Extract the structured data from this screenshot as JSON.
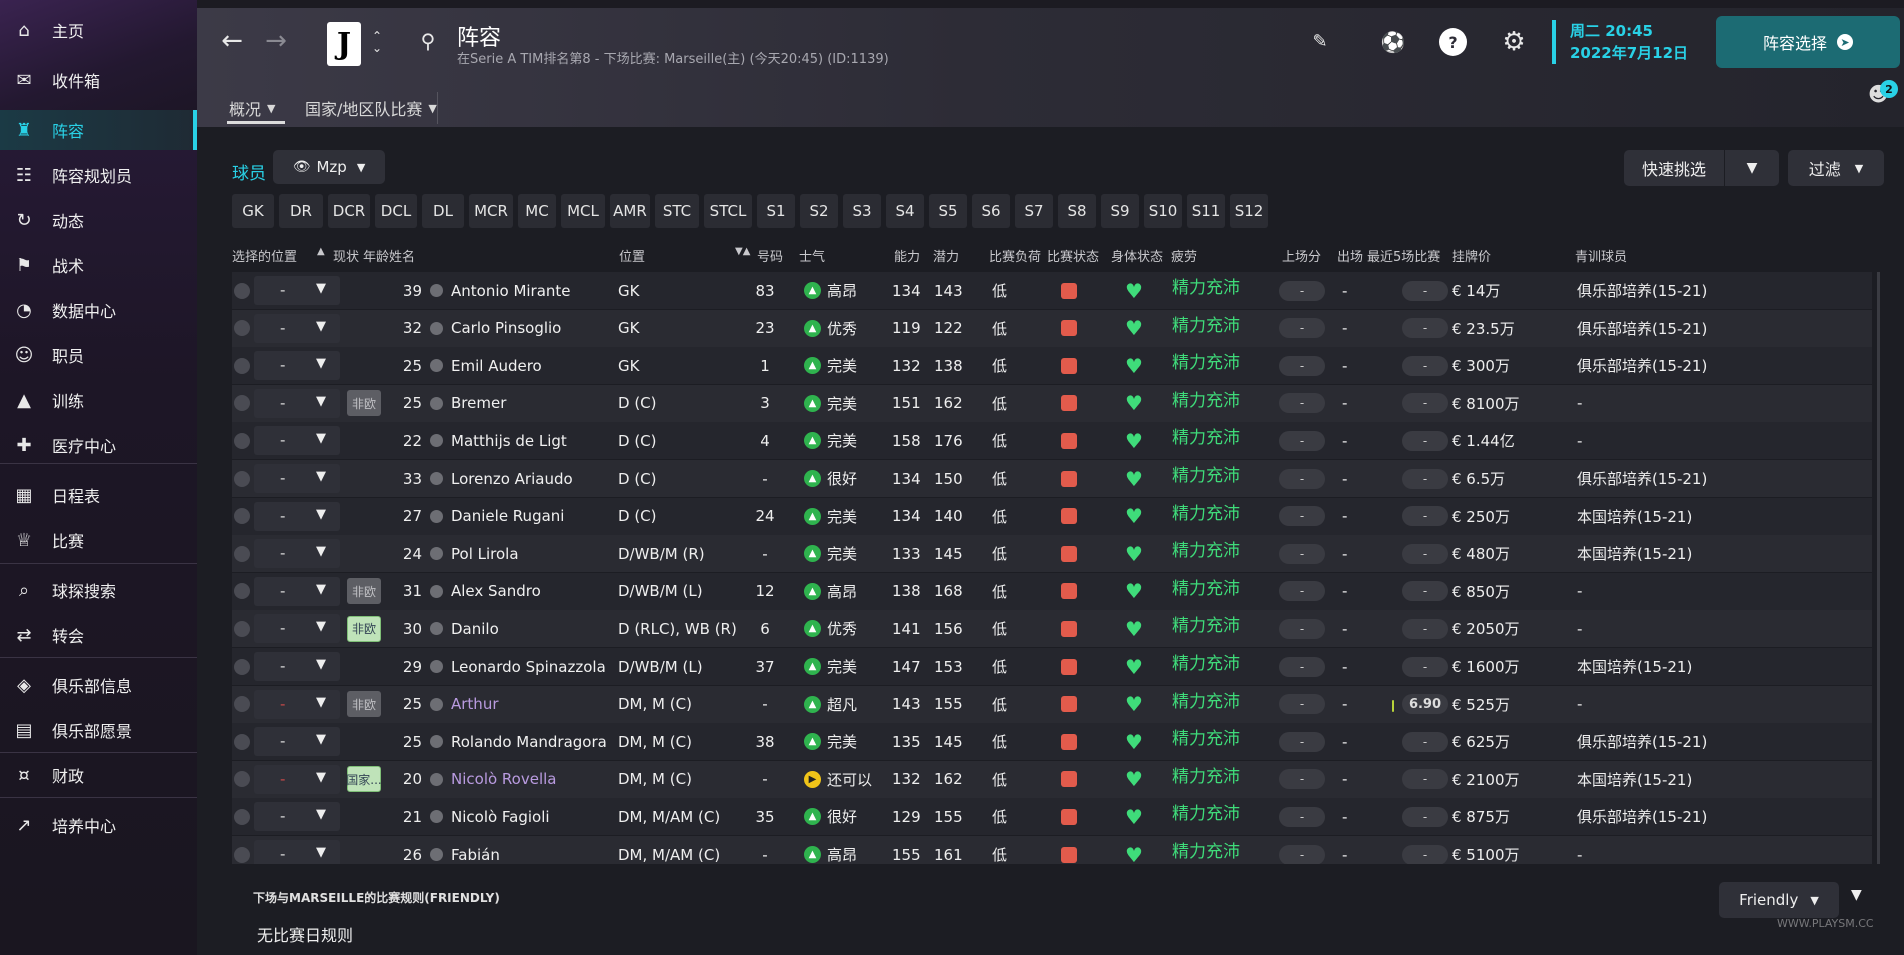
{
  "sidebar": {
    "items": [
      {
        "label": "主页",
        "icon": "home-icon"
      },
      {
        "label": "收件箱",
        "icon": "inbox-icon"
      },
      {
        "label": "阵容",
        "icon": "shirt-icon",
        "active": true
      },
      {
        "label": "阵容规划员",
        "icon": "clipboard-icon"
      },
      {
        "label": "动态",
        "icon": "dynamics-icon"
      },
      {
        "label": "战术",
        "icon": "tactics-icon"
      },
      {
        "label": "数据中心",
        "icon": "data-hub-icon"
      },
      {
        "label": "职员",
        "icon": "staff-icon"
      },
      {
        "label": "训练",
        "icon": "training-icon"
      },
      {
        "label": "医疗中心",
        "icon": "medical-icon"
      },
      {
        "label": "日程表",
        "icon": "calendar-icon"
      },
      {
        "label": "比赛",
        "icon": "trophy-icon"
      },
      {
        "label": "球探搜索",
        "icon": "scouting-icon"
      },
      {
        "label": "转会",
        "icon": "transfer-icon"
      },
      {
        "label": "俱乐部信息",
        "icon": "club-info-icon"
      },
      {
        "label": "俱乐部愿景",
        "icon": "club-vision-icon"
      },
      {
        "label": "财政",
        "icon": "finance-icon"
      },
      {
        "label": "培养中心",
        "icon": "development-icon"
      }
    ]
  },
  "header": {
    "title": "阵容",
    "subtitle": "在Serie A TIM排名第8 - 下场比赛: Marseille(主) (今天20:45) (ID:1139)",
    "club_badge": "J",
    "date_line1": "周二 20:45",
    "date_line2": "2022年7月12日",
    "squad_select_label": "阵容选择",
    "notification_count": "2",
    "tabs": [
      {
        "label": "概况",
        "active": true
      },
      {
        "label": "国家/地区队比赛",
        "active": false
      }
    ]
  },
  "main": {
    "players_label": "球员",
    "view_select": "Mzp",
    "quick_pick": "快速挑选",
    "filter": "过滤",
    "position_tabs": [
      "GK",
      "DR",
      "DCR",
      "DCL",
      "DL",
      "MCR",
      "MC",
      "MCL",
      "AMR",
      "STC",
      "STCL",
      "S1",
      "S2",
      "S3",
      "S4",
      "S5",
      "S6",
      "S7",
      "S8",
      "S9",
      "S10",
      "S11",
      "S12"
    ],
    "columns": {
      "selected_position": "选择的位置",
      "status": "现状",
      "age": "年龄",
      "name": "姓名",
      "position": "位置",
      "number": "号码",
      "morale": "士气",
      "ability": "能力",
      "potential": "潜力",
      "match_load": "比赛负荷",
      "match_condition": "比赛状态",
      "physical_condition": "身体状态",
      "fatigue": "疲劳",
      "appearances": "上场分",
      "played": "出场",
      "last5": "最近5场比赛",
      "value": "挂牌价",
      "youth": "青训球员"
    },
    "players": [
      {
        "sel": "-",
        "status": "",
        "age": "39",
        "name": "Antonio Mirante",
        "pos": "GK",
        "num": "83",
        "morale": "高昂",
        "ca": "134",
        "pa": "143",
        "load": "低",
        "fatigue": "精力充沛",
        "apps": "-",
        "played": "-",
        "last5": "-",
        "value": "€ 14万",
        "youth": "俱乐部培养(15-21)"
      },
      {
        "sel": "-",
        "status": "",
        "age": "32",
        "name": "Carlo Pinsoglio",
        "pos": "GK",
        "num": "23",
        "morale": "优秀",
        "ca": "119",
        "pa": "122",
        "load": "低",
        "fatigue": "精力充沛",
        "apps": "-",
        "played": "-",
        "last5": "-",
        "value": "€ 23.5万",
        "youth": "俱乐部培养(15-21)"
      },
      {
        "sel": "-",
        "status": "",
        "age": "25",
        "name": "Emil Audero",
        "pos": "GK",
        "num": "1",
        "morale": "完美",
        "ca": "132",
        "pa": "138",
        "load": "低",
        "fatigue": "精力充沛",
        "apps": "-",
        "played": "-",
        "last5": "-",
        "value": "€ 300万",
        "youth": "俱乐部培养(15-21)"
      },
      {
        "sel": "-",
        "status": "非欧",
        "age": "25",
        "name": "Bremer",
        "pos": "D (C)",
        "num": "3",
        "morale": "完美",
        "ca": "151",
        "pa": "162",
        "load": "低",
        "fatigue": "精力充沛",
        "apps": "-",
        "played": "-",
        "last5": "-",
        "value": "€ 8100万",
        "youth": "-"
      },
      {
        "sel": "-",
        "status": "",
        "age": "22",
        "name": "Matthijs de Ligt",
        "pos": "D (C)",
        "num": "4",
        "morale": "完美",
        "ca": "158",
        "pa": "176",
        "load": "低",
        "fatigue": "精力充沛",
        "apps": "-",
        "played": "-",
        "last5": "-",
        "value": "€ 1.44亿",
        "youth": "-"
      },
      {
        "sel": "-",
        "status": "",
        "age": "33",
        "name": "Lorenzo Ariaudo",
        "pos": "D (C)",
        "num": "-",
        "morale": "很好",
        "ca": "134",
        "pa": "150",
        "load": "低",
        "fatigue": "精力充沛",
        "apps": "-",
        "played": "-",
        "last5": "-",
        "value": "€ 6.5万",
        "youth": "俱乐部培养(15-21)"
      },
      {
        "sel": "-",
        "status": "",
        "age": "27",
        "name": "Daniele Rugani",
        "pos": "D (C)",
        "num": "24",
        "morale": "完美",
        "ca": "134",
        "pa": "140",
        "load": "低",
        "fatigue": "精力充沛",
        "apps": "-",
        "played": "-",
        "last5": "-",
        "value": "€ 250万",
        "youth": "本国培养(15-21)"
      },
      {
        "sel": "-",
        "status": "",
        "age": "24",
        "name": "Pol Lirola",
        "pos": "D/WB/M (R)",
        "num": "-",
        "morale": "完美",
        "ca": "133",
        "pa": "145",
        "load": "低",
        "fatigue": "精力充沛",
        "apps": "-",
        "played": "-",
        "last5": "-",
        "value": "€ 480万",
        "youth": "本国培养(15-21)"
      },
      {
        "sel": "-",
        "status": "非欧",
        "age": "31",
        "name": "Alex Sandro",
        "pos": "D/WB/M (L)",
        "num": "12",
        "morale": "高昂",
        "ca": "138",
        "pa": "168",
        "load": "低",
        "fatigue": "精力充沛",
        "apps": "-",
        "played": "-",
        "last5": "-",
        "value": "€ 850万",
        "youth": "-"
      },
      {
        "sel": "-",
        "status": "非欧",
        "status_green": true,
        "age": "30",
        "name": "Danilo",
        "pos": "D (RLC), WB (R)",
        "num": "6",
        "morale": "优秀",
        "ca": "141",
        "pa": "156",
        "load": "低",
        "fatigue": "精力充沛",
        "apps": "-",
        "played": "-",
        "last5": "-",
        "value": "€ 2050万",
        "youth": "-"
      },
      {
        "sel": "-",
        "status": "",
        "age": "29",
        "name": "Leonardo Spinazzola",
        "pos": "D/WB/M (L)",
        "num": "37",
        "morale": "完美",
        "ca": "147",
        "pa": "153",
        "load": "低",
        "fatigue": "精力充沛",
        "apps": "-",
        "played": "-",
        "last5": "-",
        "value": "€ 1600万",
        "youth": "本国培养(15-21)"
      },
      {
        "sel": "-",
        "sel_red": true,
        "status": "非欧",
        "age": "25",
        "name": "Arthur",
        "loan": true,
        "pos": "DM, M (C)",
        "num": "-",
        "morale": "超凡",
        "ca": "143",
        "pa": "155",
        "load": "低",
        "fatigue": "精力充沛",
        "apps": "-",
        "played": "-",
        "last5": "6.90",
        "value": "€ 525万",
        "youth": "-"
      },
      {
        "sel": "-",
        "status": "",
        "age": "25",
        "name": "Rolando Mandragora",
        "pos": "DM, M (C)",
        "num": "38",
        "morale": "完美",
        "ca": "135",
        "pa": "145",
        "load": "低",
        "fatigue": "精力充沛",
        "apps": "-",
        "played": "-",
        "last5": "-",
        "value": "€ 625万",
        "youth": "俱乐部培养(15-21)"
      },
      {
        "sel": "-",
        "sel_red": true,
        "status": "国家...",
        "status_green": true,
        "age": "20",
        "name": "Nicolò Rovella",
        "loan": true,
        "pos": "DM, M (C)",
        "num": "-",
        "morale": "还可以",
        "morale_yellow": true,
        "ca": "132",
        "pa": "162",
        "load": "低",
        "fatigue": "精力充沛",
        "apps": "-",
        "played": "-",
        "last5": "-",
        "value": "€ 2100万",
        "youth": "本国培养(15-21)"
      },
      {
        "sel": "-",
        "status": "",
        "age": "21",
        "name": "Nicolò Fagioli",
        "pos": "DM, M/AM (C)",
        "num": "35",
        "morale": "很好",
        "ca": "129",
        "pa": "155",
        "load": "低",
        "fatigue": "精力充沛",
        "apps": "-",
        "played": "-",
        "last5": "-",
        "value": "€ 875万",
        "youth": "俱乐部培养(15-21)"
      },
      {
        "sel": "-",
        "status": "",
        "age": "26",
        "name": "Fabián",
        "pos": "DM, M/AM (C)",
        "num": "-",
        "morale": "高昂",
        "ca": "155",
        "pa": "161",
        "load": "低",
        "fatigue": "精力充沛",
        "apps": "-",
        "played": "-",
        "last5": "-",
        "value": "€ 5100万",
        "youth": "-"
      }
    ],
    "rules_title": "下场与MARSEILLE的比赛规则(FRIENDLY)",
    "rules_text": "无比赛日规则",
    "friendly_label": "Friendly",
    "watermark": "WWW.PLAYSM.CC"
  },
  "colors": {
    "accent": "#29d1e6",
    "fatigue_green": "#3fdc7a",
    "condition_red": "#e25b4c"
  }
}
